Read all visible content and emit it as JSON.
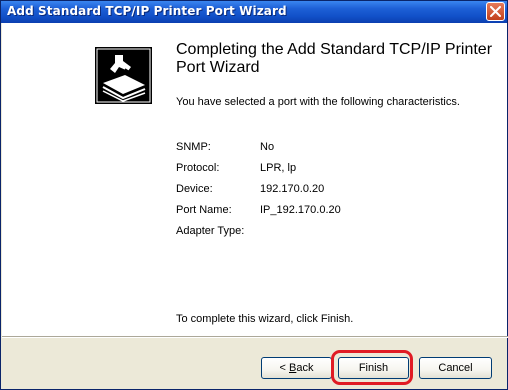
{
  "window": {
    "title": "Add Standard TCP/IP Printer Port Wizard"
  },
  "heading": "Completing the Add Standard TCP/IP Printer Port Wizard",
  "description": "You have selected a port with the following characteristics.",
  "fields": [
    {
      "label": "SNMP:",
      "value": "No"
    },
    {
      "label": "Protocol:",
      "value": "LPR, lp"
    },
    {
      "label": "Device:",
      "value": "192.170.0.20"
    },
    {
      "label": "Port Name:",
      "value": "IP_192.170.0.20"
    },
    {
      "label": "Adapter Type:",
      "value": ""
    }
  ],
  "footer": "To complete this wizard, click Finish.",
  "buttons": {
    "back": {
      "label": "< Back",
      "accelerator": "B"
    },
    "finish": {
      "label": "Finish"
    },
    "cancel": {
      "label": "Cancel"
    }
  },
  "colors": {
    "titlebar": "#1150c8",
    "highlight": "#e01b24",
    "dialog_face": "#ece9d8"
  },
  "icons": [
    "wizard-printer-icon",
    "close-icon"
  ]
}
